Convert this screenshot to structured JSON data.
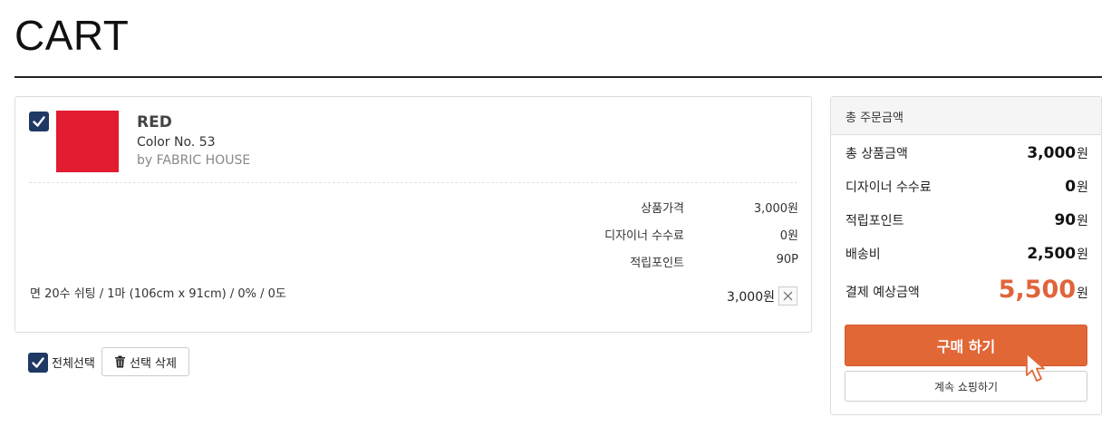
{
  "page": {
    "title": "CART"
  },
  "item": {
    "name": "RED",
    "color_no": "Color No. 53",
    "brand": "by FABRIC HOUSE",
    "swatch_color": "#e21b30",
    "checked": true,
    "price_rows": [
      {
        "label": "상품가격",
        "value": "3,000원"
      },
      {
        "label": "디자이너 수수료",
        "value": "0원"
      },
      {
        "label": "적립포인트",
        "value": "90P"
      }
    ],
    "option": "면 20수 쉬팅 / 1마 (106cm x 91cm) / 0% / 0도",
    "total": "3,000원"
  },
  "bulk": {
    "select_all_label": "전체선택",
    "delete_selected_label": "선택 삭제"
  },
  "summary": {
    "heading": "총 주문금액",
    "rows": [
      {
        "label": "총 상품금액",
        "amount": "3,000",
        "unit": "원"
      },
      {
        "label": "디자이너 수수료",
        "amount": "0",
        "unit": "원"
      },
      {
        "label": "적립포인트",
        "amount": "90",
        "unit": "원"
      },
      {
        "label": "배송비",
        "amount": "2,500",
        "unit": "원"
      }
    ],
    "total": {
      "label": "결제 예상금액",
      "amount": "5,500",
      "unit": "원"
    },
    "buy_label": "구매 하기",
    "continue_label": "계속 쇼핑하기"
  },
  "colors": {
    "accent": "#e26737",
    "checkbox": "#1f3864",
    "total_amount": "#e0643a"
  }
}
